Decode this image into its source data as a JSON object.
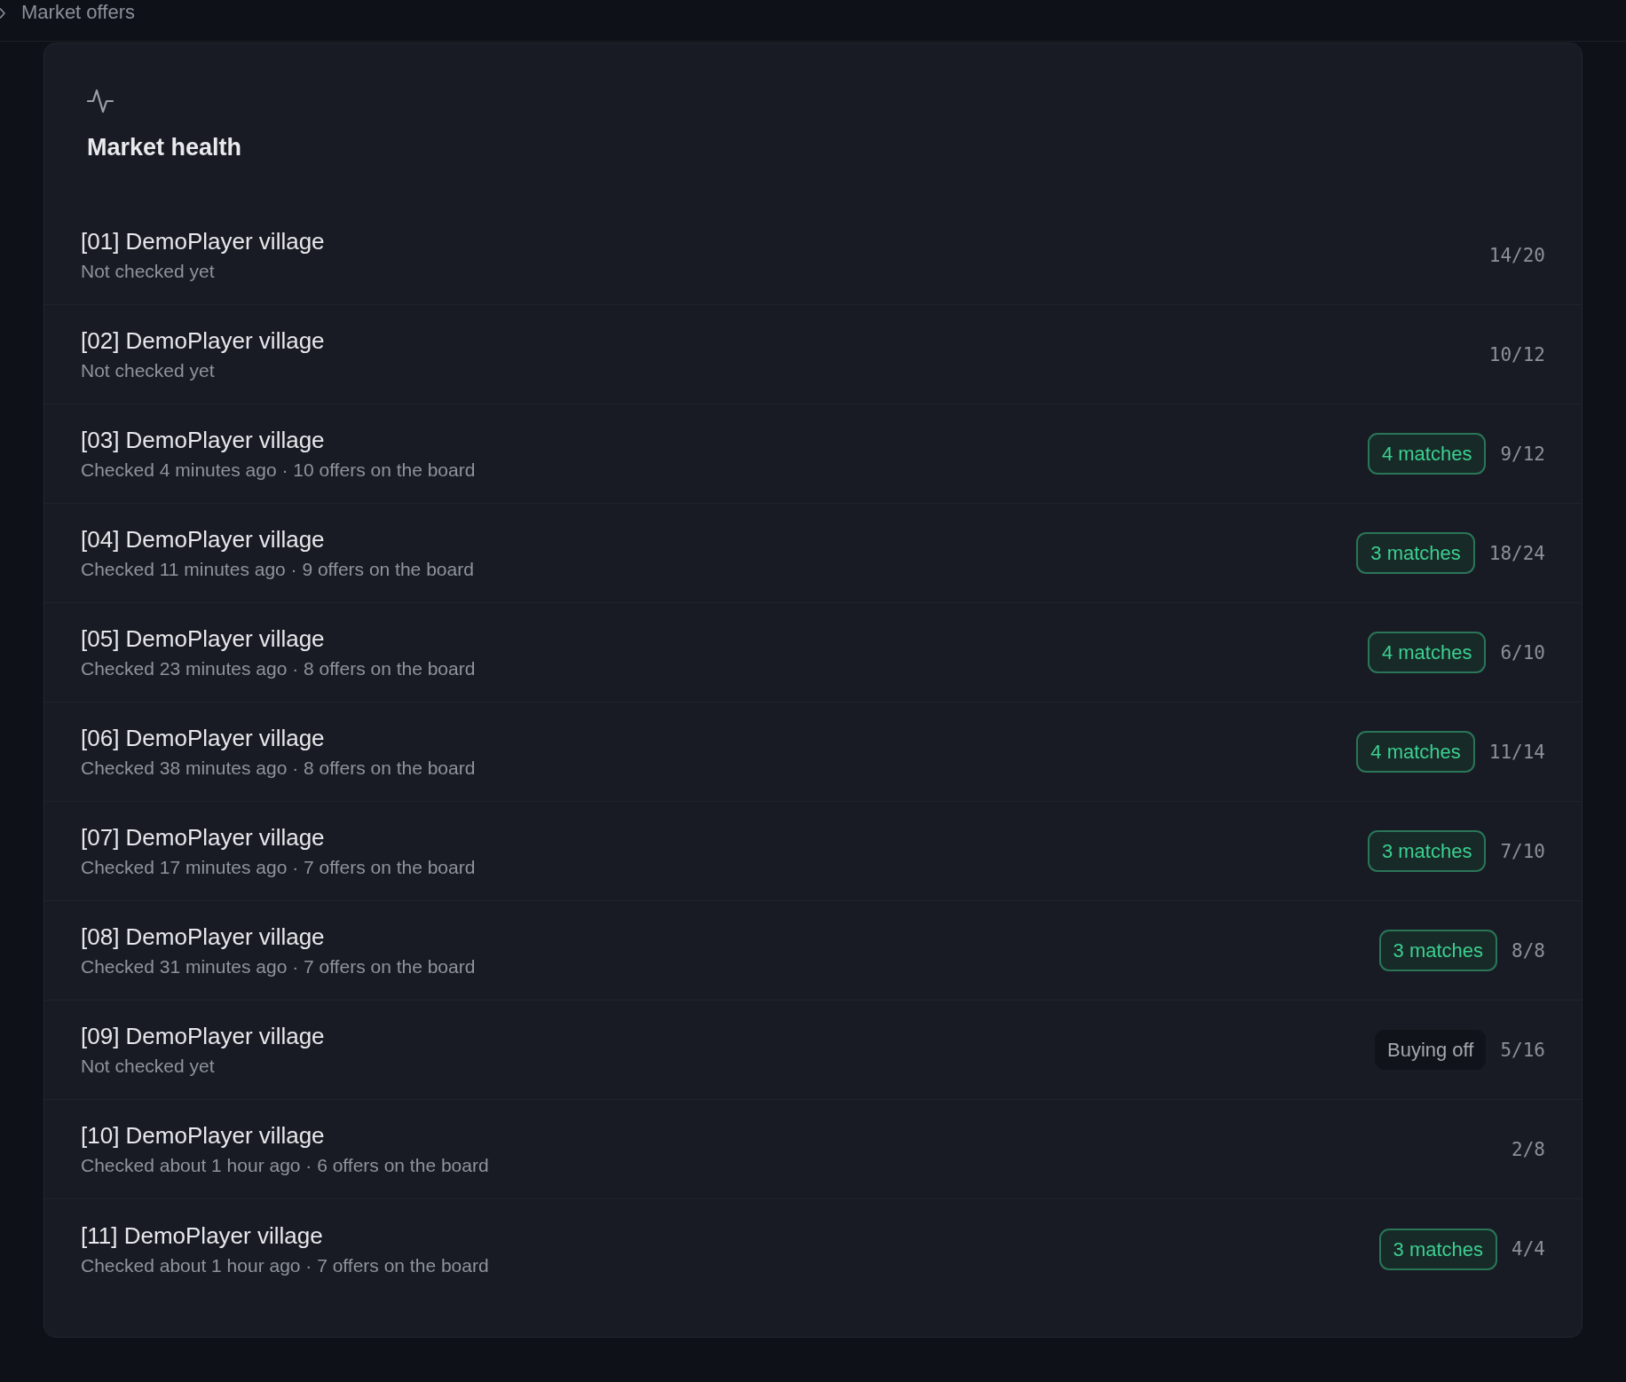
{
  "breadcrumb": {
    "label": "Market offers"
  },
  "panel": {
    "title": "Market health"
  },
  "villages": [
    {
      "name": "[01] DemoPlayer village",
      "status": "Not checked yet",
      "count": "14/20"
    },
    {
      "name": "[02] DemoPlayer village",
      "status": "Not checked yet",
      "count": "10/12"
    },
    {
      "name": "[03] DemoPlayer village",
      "status": "Checked 4 minutes ago · 10 offers on the board",
      "tag": {
        "kind": "matches",
        "label": "4 matches"
      },
      "count": "9/12"
    },
    {
      "name": "[04] DemoPlayer village",
      "status": "Checked 11 minutes ago · 9 offers on the board",
      "tag": {
        "kind": "matches",
        "label": "3 matches"
      },
      "count": "18/24"
    },
    {
      "name": "[05] DemoPlayer village",
      "status": "Checked 23 minutes ago · 8 offers on the board",
      "tag": {
        "kind": "matches",
        "label": "4 matches"
      },
      "count": "6/10"
    },
    {
      "name": "[06] DemoPlayer village",
      "status": "Checked 38 minutes ago · 8 offers on the board",
      "tag": {
        "kind": "matches",
        "label": "4 matches"
      },
      "count": "11/14"
    },
    {
      "name": "[07] DemoPlayer village",
      "status": "Checked 17 minutes ago · 7 offers on the board",
      "tag": {
        "kind": "matches",
        "label": "3 matches"
      },
      "count": "7/10"
    },
    {
      "name": "[08] DemoPlayer village",
      "status": "Checked 31 minutes ago · 7 offers on the board",
      "tag": {
        "kind": "matches",
        "label": "3 matches"
      },
      "count": "8/8"
    },
    {
      "name": "[09] DemoPlayer village",
      "status": "Not checked yet",
      "tag": {
        "kind": "buying_off",
        "label": "Buying off"
      },
      "count": "5/16"
    },
    {
      "name": "[10] DemoPlayer village",
      "status": "Checked about 1 hour ago · 6 offers on the board",
      "count": "2/8"
    },
    {
      "name": "[11] DemoPlayer village",
      "status": "Checked about 1 hour ago · 7 offers on the board",
      "tag": {
        "kind": "matches",
        "label": "3 matches"
      },
      "count": "4/4"
    }
  ]
}
